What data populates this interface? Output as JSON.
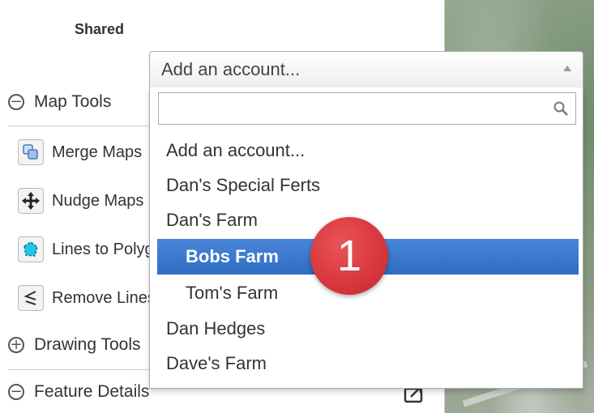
{
  "panel": {
    "shared_label": "Shared",
    "sections": {
      "map_tools": {
        "label": "Map Tools",
        "symbol": "−"
      },
      "drawing_tools": {
        "label": "Drawing Tools",
        "symbol": "+"
      },
      "feature_details": {
        "label": "Feature Details",
        "symbol": "−"
      }
    },
    "tools": [
      {
        "label": "Merge Maps",
        "icon": "merge-maps-icon"
      },
      {
        "label": "Nudge Maps",
        "icon": "nudge-icon"
      },
      {
        "label": "Lines to Polygons",
        "icon": "lines-to-polygons-icon"
      },
      {
        "label": "Remove Lines",
        "icon": "remove-lines-icon"
      }
    ]
  },
  "dropdown": {
    "selected": "Add an account...",
    "search_value": "",
    "options": [
      {
        "label": "Add an account...",
        "level": 0
      },
      {
        "label": "Dan's Special Ferts",
        "level": 0
      },
      {
        "label": "Dan's Farm",
        "level": 0
      },
      {
        "label": "Bobs Farm",
        "level": 1,
        "highlighted": true
      },
      {
        "label": "Tom's Farm",
        "level": 1
      },
      {
        "label": "Dan Hedges",
        "level": 0
      },
      {
        "label": "Dave's Farm",
        "level": 0
      }
    ]
  },
  "callout": {
    "number": "1",
    "color": "#d9383e"
  },
  "colors": {
    "highlight": "#3875d7",
    "text": "#333333"
  }
}
